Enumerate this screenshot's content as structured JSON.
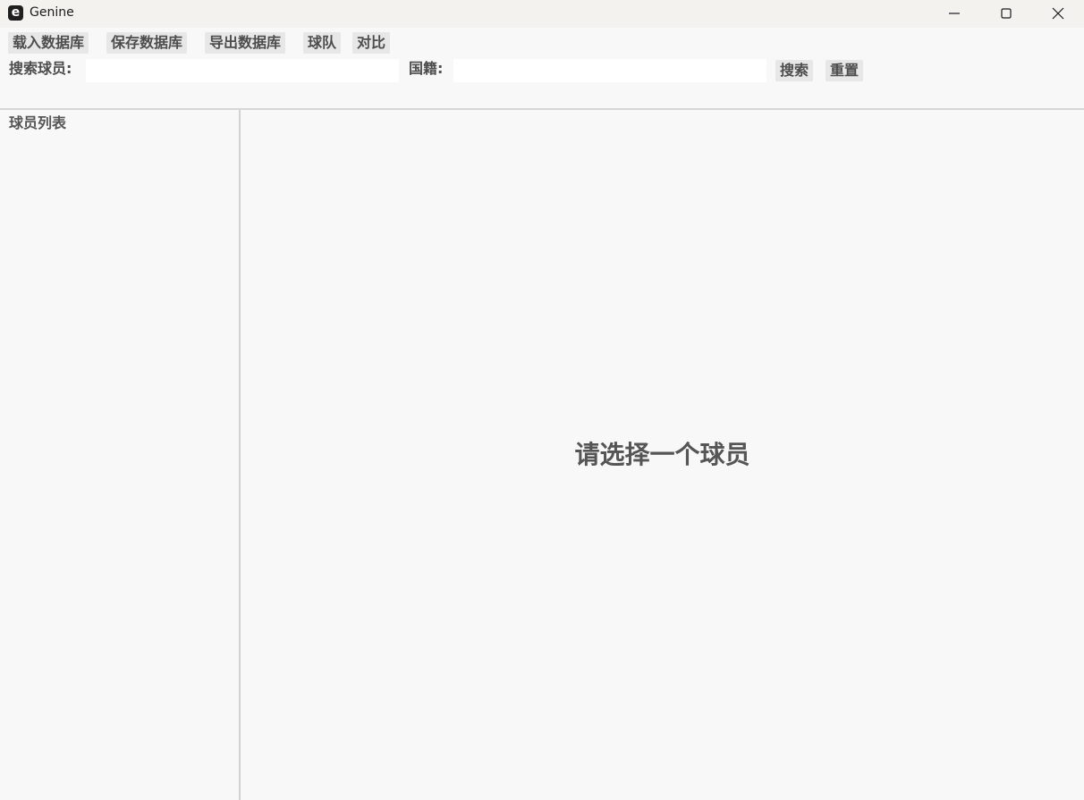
{
  "window": {
    "icon_letter": "e",
    "title": "Genine"
  },
  "menu": {
    "load_db": "载入数据库",
    "save_db": "保存数据库",
    "export_db": "导出数据库",
    "teams": "球队",
    "compare": "对比"
  },
  "search": {
    "player_label": "搜索球员:",
    "player_value": "",
    "nationality_label": "国籍:",
    "nationality_value": "",
    "search_button": "搜索",
    "reset_button": "重置"
  },
  "sidebar": {
    "title": "球员列表"
  },
  "main": {
    "empty_message": "请选择一个球员"
  },
  "colors": {
    "background": "#f8f8f8",
    "titlebar": "#f4f2ef",
    "button": "#e7e7e7",
    "text": "#555555"
  }
}
